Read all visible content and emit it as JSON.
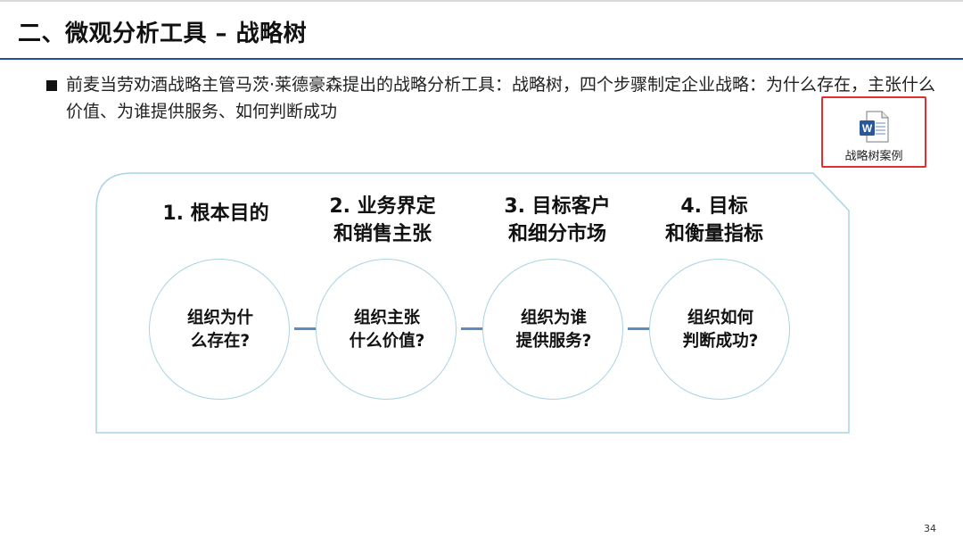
{
  "title": "二、微观分析工具 – 战略树",
  "intro": "前麦当劳劝酒战略主管马茨·莱德豪森提出的战略分析工具：战略树，四个步骤制定企业战略：为什么存在，主张什么价值、为谁提供服务、如何判断成功",
  "attachment": {
    "label": "战略树案例",
    "icon": "word-document-icon"
  },
  "steps": [
    {
      "title": "1. 根本目的",
      "question": "组织为什\n么存在?"
    },
    {
      "title": "2. 业务界定\n和销售主张",
      "question": "组织主张\n什么价值?"
    },
    {
      "title": "3. 目标客户\n和细分市场",
      "question": "组织为谁\n提供服务?"
    },
    {
      "title": "4. 目标\n和衡量指标",
      "question": "组织如何\n判断成功?"
    }
  ],
  "page_number": "34",
  "colors": {
    "title_rule": "#1f4e9c",
    "frame_border": "#a9d3e3",
    "connector": "#5d8cc4",
    "highlight_box": "#e03030"
  }
}
